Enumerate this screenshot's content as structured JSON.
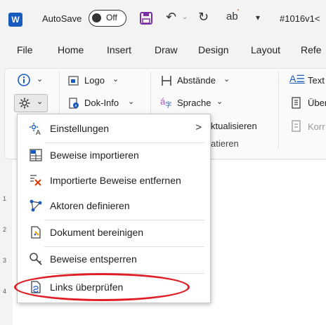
{
  "titlebar": {
    "autosave_label": "AutoSave",
    "toggle_label": "Off",
    "doc_title": "#1016v1<",
    "word_logo": "W",
    "undo_symbol": "↶",
    "redo_symbol": "↻",
    "more_symbol": "▾",
    "ab_symbol": "ab"
  },
  "tabs": [
    "File",
    "Home",
    "Insert",
    "Draw",
    "Design",
    "Layout",
    "Refe"
  ],
  "ribbon": {
    "logo_label": "Logo",
    "dokinfo_label": "Dok-Info",
    "abstaende_label": "Abstände",
    "sprache_label": "Sprache",
    "text_label": "Text",
    "ueber_label": "Über",
    "korr_label": "Korr",
    "aktualisieren_label": "ktualisieren",
    "formatieren_label": "atieren"
  },
  "menu": {
    "items": [
      {
        "label": "Einstellungen",
        "icon": "settings-language-icon"
      },
      {
        "label": "Beweise importieren",
        "icon": "import-evidence-icon"
      },
      {
        "label": "Importierte Beweise entfernen",
        "icon": "remove-evidence-icon"
      },
      {
        "label": "Aktoren definieren",
        "icon": "actors-icon"
      },
      {
        "label": "Dokument bereinigen",
        "icon": "clean-document-icon"
      },
      {
        "label": "Beweise entsperren",
        "icon": "unlock-evidence-icon"
      },
      {
        "label": "Links überprüfen",
        "icon": "check-links-icon"
      }
    ]
  },
  "ruler_numbers": [
    "1",
    "2",
    "3",
    "4"
  ],
  "colors": {
    "accent": "#185abd",
    "highlight": "#e01e26",
    "save": "#7a2fa0"
  }
}
